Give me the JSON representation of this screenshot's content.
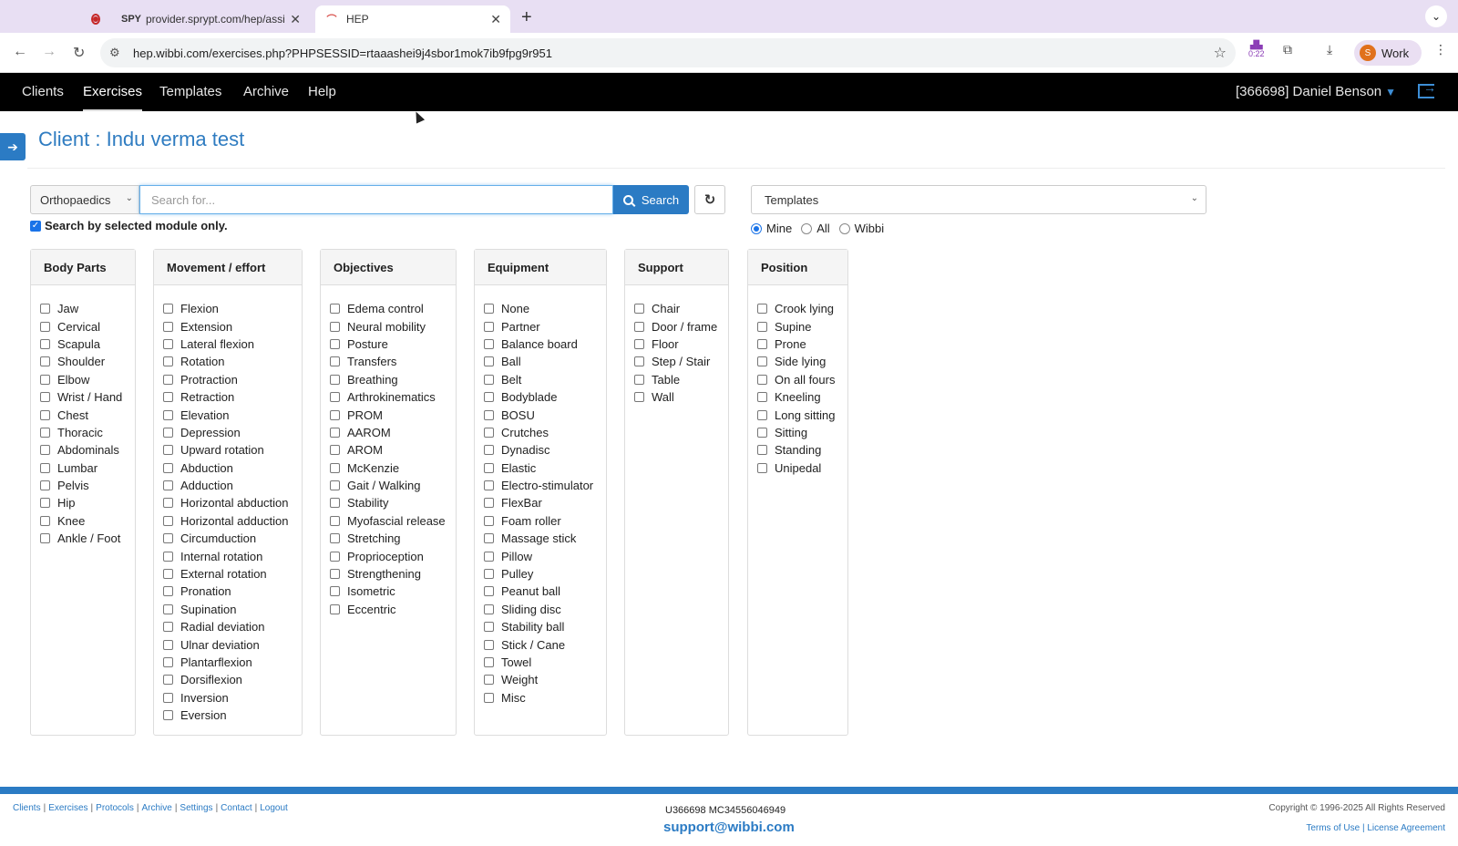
{
  "browser": {
    "tabs": [
      {
        "title": "provider.sprypt.com/hep/assi",
        "favicon": "SPY"
      },
      {
        "title": "HEP",
        "favicon": "hep-icon"
      }
    ],
    "url": "hep.wibbi.com/exercises.php?PHPSESSID=rtaaashei9j4sbor1mok7ib9fpg9r951",
    "ext_timer": "0:22",
    "profile_initial": "S",
    "profile_label": "Work"
  },
  "nav": {
    "links": [
      "Clients",
      "Exercises",
      "Templates",
      "Archive",
      "Help"
    ],
    "active": "Exercises",
    "user": "[366698] Daniel Benson"
  },
  "page": {
    "title": "Client : Indu verma test",
    "module": "Orthopaedics",
    "search_placeholder": "Search for...",
    "search_label": "Search",
    "only_module_label": "Search by selected module only.",
    "templates_label": "Templates",
    "radios": [
      "Mine",
      "All",
      "Wibbi"
    ]
  },
  "filters": {
    "body_parts": {
      "title": "Body Parts",
      "items": [
        "Jaw",
        "Cervical",
        "Scapula",
        "Shoulder",
        "Elbow",
        "Wrist / Hand",
        "Chest",
        "Thoracic",
        "Abdominals",
        "Lumbar",
        "Pelvis",
        "Hip",
        "Knee",
        "Ankle / Foot"
      ]
    },
    "movement": {
      "title": "Movement / effort",
      "items": [
        "Flexion",
        "Extension",
        "Lateral flexion",
        "Rotation",
        "Protraction",
        "Retraction",
        "Elevation",
        "Depression",
        "Upward rotation",
        "Abduction",
        "Adduction",
        "Horizontal abduction",
        "Horizontal adduction",
        "Circumduction",
        "Internal rotation",
        "External rotation",
        "Pronation",
        "Supination",
        "Radial deviation",
        "Ulnar deviation",
        "Plantarflexion",
        "Dorsiflexion",
        "Inversion",
        "Eversion"
      ]
    },
    "objectives": {
      "title": "Objectives",
      "items": [
        "Edema control",
        "Neural mobility",
        "Posture",
        "Transfers",
        "Breathing",
        "Arthrokinematics",
        "PROM",
        "AAROM",
        "AROM",
        "McKenzie",
        "Gait / Walking",
        "Stability",
        "Myofascial release",
        "Stretching",
        "Proprioception",
        "Strengthening",
        "Isometric",
        "Eccentric"
      ]
    },
    "equipment": {
      "title": "Equipment",
      "items": [
        "None",
        "Partner",
        "Balance board",
        "Ball",
        "Belt",
        "Bodyblade",
        "BOSU",
        "Crutches",
        "Dynadisc",
        "Elastic",
        "Electro-stimulator",
        "FlexBar",
        "Foam roller",
        "Massage stick",
        "Pillow",
        "Pulley",
        "Peanut ball",
        "Sliding disc",
        "Stability ball",
        "Stick / Cane",
        "Towel",
        "Weight",
        "Misc"
      ]
    },
    "support": {
      "title": "Support",
      "items": [
        "Chair",
        "Door / frame",
        "Floor",
        "Step / Stair",
        "Table",
        "Wall"
      ]
    },
    "position": {
      "title": "Position",
      "items": [
        "Crook lying",
        "Supine",
        "Prone",
        "Side lying",
        "On all fours",
        "Kneeling",
        "Long sitting",
        "Sitting",
        "Standing",
        "Unipedal"
      ]
    }
  },
  "footer": {
    "links": [
      "Clients",
      "Exercises",
      "Protocols",
      "Archive",
      "Settings",
      "Contact",
      "Logout"
    ],
    "ids": "U366698 MC34556046949",
    "email": "support@wibbi.com",
    "copyright": "Copyright © 1996-2025 All Rights Reserved",
    "terms": "Terms of Use",
    "license": "License Agreement"
  },
  "colors": {
    "accent": "#2b7bc4",
    "nav_bg": "#000000",
    "tabbar": "#e8dff3"
  }
}
